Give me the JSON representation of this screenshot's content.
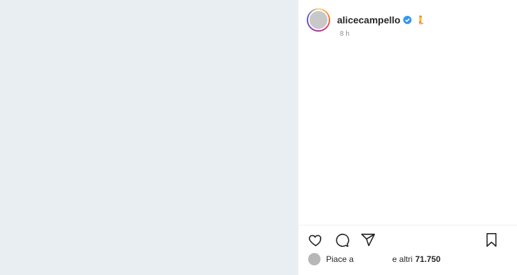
{
  "post": {
    "username": "alicecampello",
    "time": "8 h",
    "extra_emoji": "🧜",
    "likes_prefix": "Piace a",
    "likes_middle": "e altri",
    "likes_count": "71.750"
  },
  "icons": [
    "heart-icon",
    "comment-icon",
    "share-icon",
    "bookmark-icon"
  ],
  "colors": {
    "accent": "#3897f0",
    "muted": "#8e8e8e",
    "text": "#262626"
  }
}
